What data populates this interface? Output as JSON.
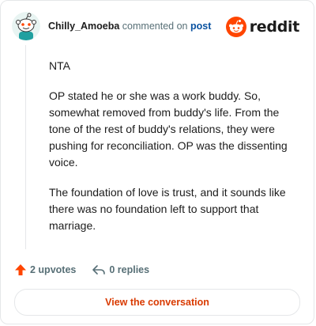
{
  "header": {
    "username": "Chilly_Amoeba",
    "action_text": "commented on",
    "post_link": "post",
    "brand": "reddit"
  },
  "comment": {
    "paragraphs": [
      "NTA",
      "OP stated he or she was a work buddy. So, somewhat removed from buddy's life. From the tone of the rest of buddy's relations, they were pushing for reconciliation. OP was the dissenting voice.",
      "The foundation of love is trust, and it sounds like there was no foundation left to support that marriage."
    ]
  },
  "footer": {
    "upvotes": "2 upvotes",
    "replies": "0 replies",
    "cta": "View the conversation"
  },
  "icons": {
    "upvote": "upvote-arrow-icon",
    "reply": "reply-arrow-icon",
    "logo": "reddit-snoo-icon"
  },
  "colors": {
    "brand_orange": "#ff4500",
    "upvote": "#ff4500",
    "link": "#0a52a0",
    "cta_text": "#d93a00",
    "muted": "#576f76"
  }
}
